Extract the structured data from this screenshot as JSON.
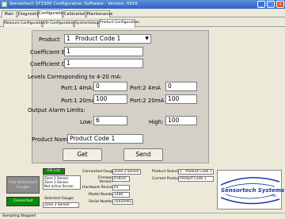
{
  "window": {
    "title": "Sensortech ST3300 Configuration Software - Version: 0016"
  },
  "tabs": [
    "Main",
    "Diagnostics",
    "Configuration",
    "Calibration",
    "Maintenance"
  ],
  "subtabs": [
    "Measure Configuration",
    "I/O Configuration",
    "SystemSetup",
    "Product Configuration"
  ],
  "form": {
    "product_label": "Product",
    "product_number": "1",
    "product_value": "Product Code 1",
    "coef_b_label": "Coefficient B",
    "coef_b_value": "1",
    "coef_c_label": "Coefficient C",
    "coef_c_value": "1",
    "levels_label": "Levels Corresponding to 4-20 mA:",
    "port1_4_label": "Port:1  4mA:",
    "port1_4_value": "0",
    "port2_4_label": "Port:2  4mA",
    "port2_4_value": "0",
    "port1_20_label": "Port:1 20mA:",
    "port1_20_value": "100",
    "port2_20_label": "Port:2 20mA",
    "port2_20_value": "100",
    "alarm_label": "Output Alarm Limits:",
    "low_label": "Low:",
    "low_value": "6",
    "high_label": "High:",
    "high_value": "100",
    "product_name_label": "Product Name:",
    "product_name_value": "Product Code 1",
    "get_label": "Get",
    "send_label": "Send"
  },
  "bottom": {
    "find_button": "Find Networked Gauges",
    "mode_value": "Fill List",
    "gauge_list": [
      "Zone 1 Sensor",
      "Zone 2 Sensor",
      "Not active Sensor"
    ],
    "connected_button": "Connected",
    "selected_gauge_label": "Selected Gauge:",
    "selected_gauge_value": "Zone 2 Sensor",
    "connected_gauge_label": "Connected Gauge",
    "connected_gauge_value": "Zone 2 Sensor",
    "firmware_label": "Firmware Version",
    "firmware_value": "0.0035",
    "hardware_label": "Hardware Revision",
    "hardware_value": "A1",
    "model_label": "Model Number",
    "model_value": "3300",
    "serial_label": "Serial Number",
    "serial_value": "15020001",
    "product_select_label": "Product Select",
    "product_select_number": "1",
    "product_select_value": "Product Code 1",
    "current_product_label": "Current Product",
    "current_product_value": "Product Code 1",
    "logo_text": "Sensortech Systems",
    "logo_sub": "Inc."
  },
  "status": {
    "text": "Sampling Stopped"
  },
  "colors": {
    "titlebar": "#2f63c0",
    "green": "#0a8a0a",
    "panel": "#d4d0c8",
    "logo_blue": "#1a3c9e"
  }
}
